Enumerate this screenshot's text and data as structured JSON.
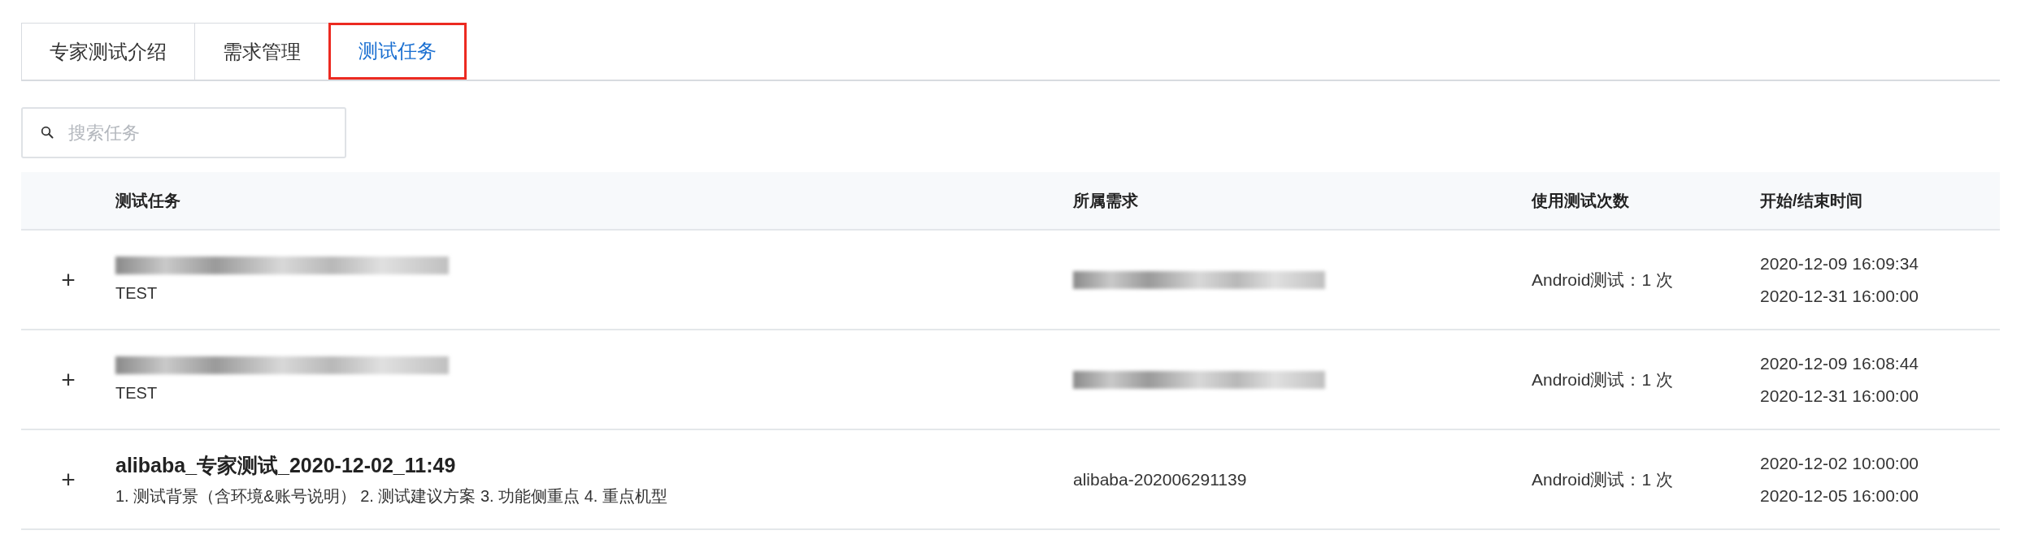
{
  "tabs": [
    {
      "label": "专家测试介绍",
      "selected": false
    },
    {
      "label": "需求管理",
      "selected": false
    },
    {
      "label": "测试任务",
      "selected": true
    }
  ],
  "search": {
    "placeholder": "搜索任务"
  },
  "table": {
    "columns": [
      "测试任务",
      "所属需求",
      "使用测试次数",
      "开始/结束时间"
    ],
    "rows": [
      {
        "expander": "+",
        "title_redacted": true,
        "description": "TEST",
        "requirement_redacted": true,
        "usage": "Android测试：1 次",
        "start": "2020-12-09 16:09:34",
        "end": "2020-12-31 16:00:00"
      },
      {
        "expander": "+",
        "title_redacted": true,
        "description": "TEST",
        "requirement_redacted": true,
        "usage": "Android测试：1 次",
        "start": "2020-12-09 16:08:44",
        "end": "2020-12-31 16:00:00"
      },
      {
        "expander": "+",
        "title": "alibaba_专家测试_2020-12-02_11:49",
        "description": "1. 测试背景（含环境&账号说明） 2. 测试建议方案 3. 功能侧重点 4. 重点机型",
        "requirement": "alibaba-202006291139",
        "usage": "Android测试：1 次",
        "start": "2020-12-02 10:00:00",
        "end": "2020-12-05 16:00:00"
      }
    ]
  }
}
